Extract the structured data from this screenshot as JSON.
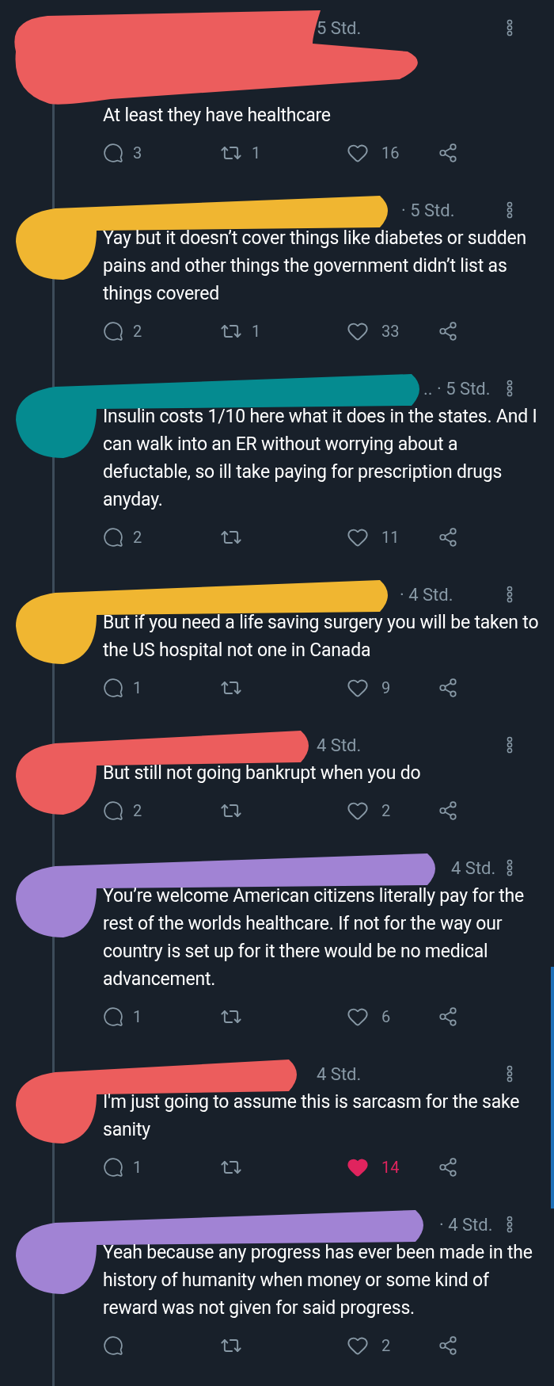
{
  "tweets": [
    {
      "color": "#ec5d5d",
      "time": "5 Std.",
      "text": "At least they have healthcare",
      "replies": "3",
      "retweets": "1",
      "likes": "16",
      "liked": false
    },
    {
      "color": "#f0b631",
      "time": "· 5 Std.",
      "text": "Yay but it doesn’t cover things like diabetes or sudden pains and other things the government didn’t list as things covered",
      "replies": "2",
      "retweets": "1",
      "likes": "33",
      "liked": false
    },
    {
      "color": "#058b90",
      "time": ".. · 5 Std.",
      "text": "Insulin costs 1/10 here what it does in the states. And I can walk into an ER without worrying about a defuctable, so ill take paying for prescription drugs anyday.",
      "replies": "2",
      "likes": "11",
      "liked": false
    },
    {
      "color": "#f0b631",
      "time": "· 4 Std.",
      "text": "But if you need a life saving surgery you will be taken to the US hospital not one in Canada",
      "replies": "1",
      "likes": "9",
      "liked": false
    },
    {
      "color": "#ec5d5d",
      "time": "4 Std.",
      "text": "But still not going bankrupt when you do",
      "replies": "2",
      "likes": "2",
      "liked": false
    },
    {
      "color": "#a183d4",
      "time": "4 Std.",
      "text": "You’re welcome American citizens literally pay for the rest of the worlds healthcare. If not for the way our country is set up for it there would be no medical advancement.",
      "replies": "1",
      "likes": "6",
      "liked": false
    },
    {
      "color": "#ec5d5d",
      "time": "4 Std.",
      "text": "I'm just going to assume this is sarcasm for the sake sanity",
      "replies": "1",
      "likes": "14",
      "liked": true
    },
    {
      "color": "#a183d4",
      "time": "· 4 Std.",
      "text": "Yeah because any progress has ever been made in the history of humanity when money or some kind of reward was not given for said progress.",
      "likes": "2",
      "liked": false
    }
  ]
}
